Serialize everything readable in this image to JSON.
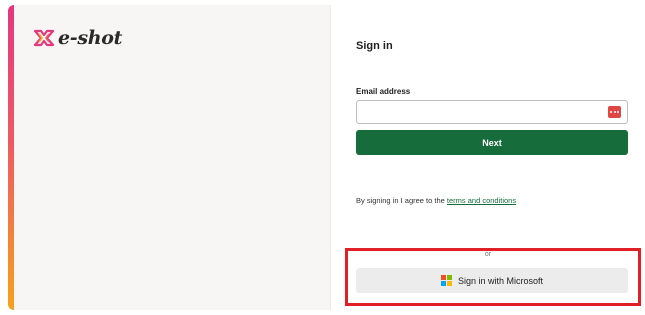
{
  "brand": {
    "name": "e-shot",
    "logo_icon": "eshot-x-mark-icon",
    "accent_colors": [
      "#e3377f",
      "#f6a11c"
    ]
  },
  "signin": {
    "title": "Sign in",
    "email_label": "Email address",
    "email_value": "",
    "email_placeholder": "",
    "autofill_icon": "password-manager-icon",
    "next_label": "Next",
    "terms_prefix": "By signing in I agree to the ",
    "terms_link": "terms and conditions",
    "or_text": "or",
    "microsoft_label": "Sign in with Microsoft",
    "microsoft_icon": "microsoft-logo-icon"
  },
  "colors": {
    "primary_green": "#166c3b",
    "highlight_red": "#e01f26",
    "ms_button_bg": "#ececec"
  }
}
